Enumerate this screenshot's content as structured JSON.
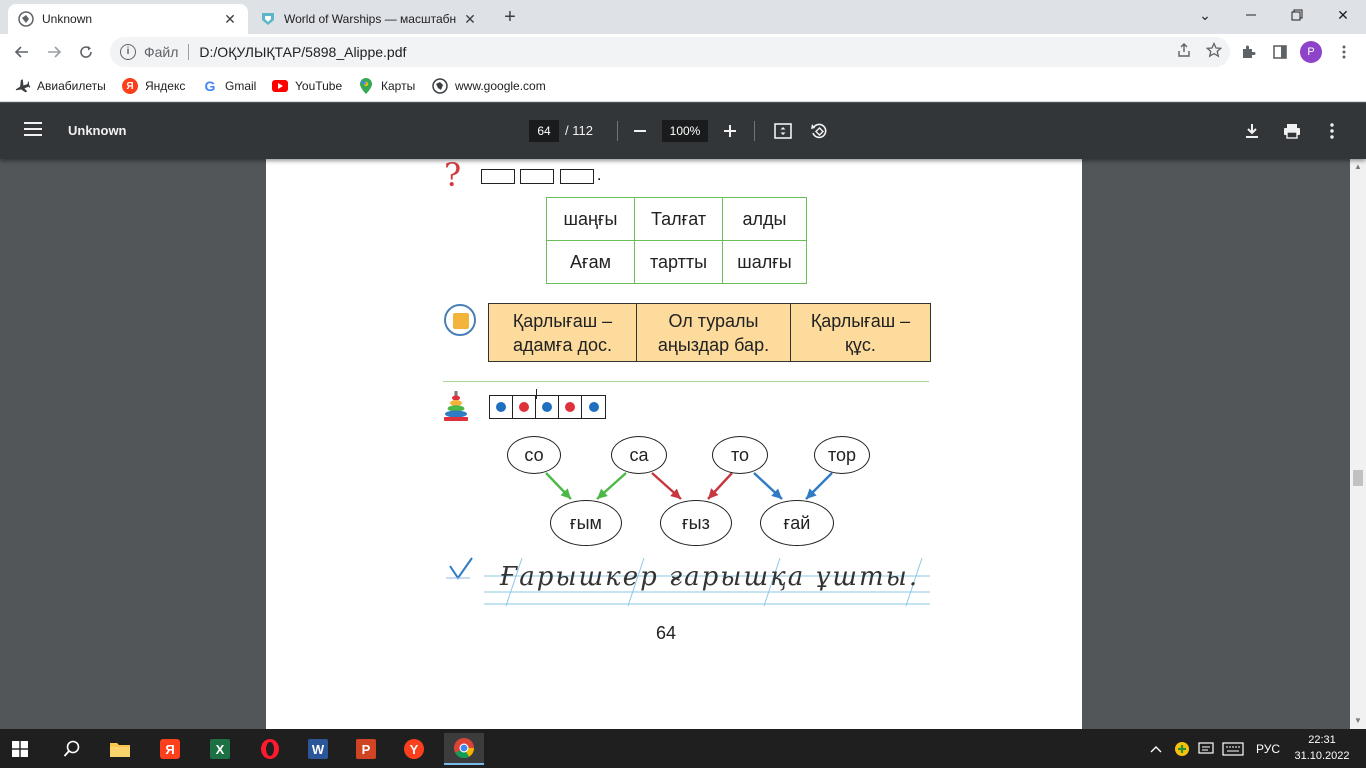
{
  "browser": {
    "tabs": [
      {
        "title": "Unknown",
        "active": true
      },
      {
        "title": "World of Warships — масштабн",
        "active": false
      }
    ],
    "address": {
      "scheme_label": "Файл",
      "url": "D:/ОҚУЛЫҚТАР/5898_Alippe.pdf"
    },
    "profile_initial": "P",
    "bookmarks": [
      {
        "label": "Авиабилеты",
        "icon": "airplane-icon"
      },
      {
        "label": "Яндекс",
        "icon": "yandex-icon"
      },
      {
        "label": "Gmail",
        "icon": "google-icon"
      },
      {
        "label": "YouTube",
        "icon": "youtube-icon"
      },
      {
        "label": "Карты",
        "icon": "maps-icon"
      },
      {
        "label": "www.google.com",
        "icon": "globe-icon"
      }
    ]
  },
  "pdf": {
    "title": "Unknown",
    "current_page": "64",
    "total_pages": "/ 112",
    "zoom": "100%"
  },
  "content": {
    "word_table": [
      [
        "шаңғы",
        "Талғат",
        "алды"
      ],
      [
        "Ағам",
        "тартты",
        "шалғы"
      ]
    ],
    "sentences": [
      [
        "Қарлығаш –",
        "адамға дос."
      ],
      [
        "Ол туралы",
        "аңыздар бар."
      ],
      [
        "Қарлығаш –",
        "құс."
      ]
    ],
    "dot_pattern": [
      "#1f6fc1",
      "#e0303a",
      "#1f6fc1",
      "#e0303a",
      "#1f6fc1"
    ],
    "top_syllables": [
      "со",
      "са",
      "то",
      "тор"
    ],
    "bottom_syllables": [
      "ғым",
      "ғыз",
      "ғай"
    ],
    "arrow_colors": {
      "green": "#4db848",
      "red": "#c8373f",
      "blue": "#2f7bc4"
    },
    "handwriting": "Ғарышкер ғарышқа ұшты.",
    "page_number": "64"
  },
  "taskbar": {
    "language": "РУС",
    "time": "22:31",
    "date": "31.10.2022"
  }
}
